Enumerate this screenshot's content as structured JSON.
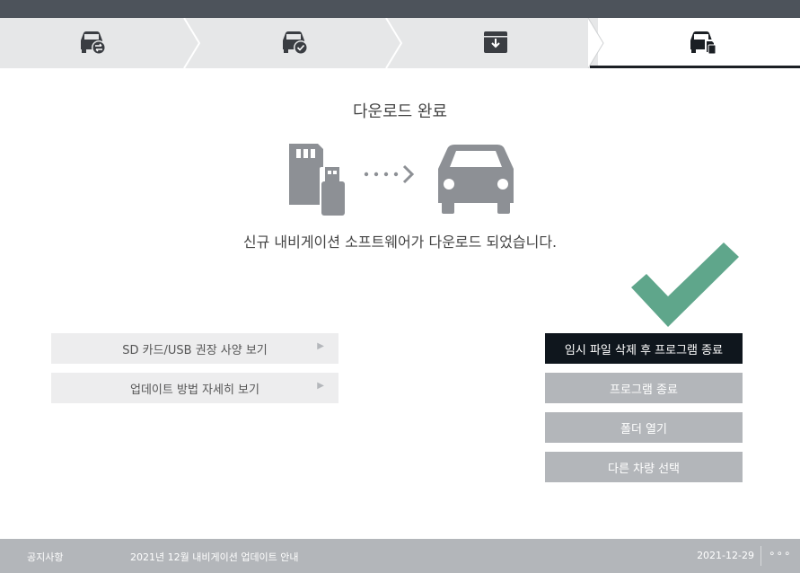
{
  "steps": [
    {
      "icon": "car-swap-icon",
      "active": false
    },
    {
      "icon": "car-check-icon",
      "active": false
    },
    {
      "icon": "download-box-icon",
      "active": false
    },
    {
      "icon": "car-sd-card-icon",
      "active": true
    }
  ],
  "main": {
    "title": "다운로드 완료",
    "message": "신규 내비게이션 소프트웨어가 다운로드 되었습니다."
  },
  "links": {
    "sd_usb_spec": "SD 카드/USB 권장 사양 보기",
    "update_method": "업데이트 방법 자세히 보기",
    "arrow": "▶"
  },
  "actions": {
    "delete_and_exit": "임시 파일 삭제 후 프로그램 종료",
    "exit": "프로그램 종료",
    "open_folder": "폴더 열기",
    "select_other_vehicle": "다른 차량 선택"
  },
  "footer": {
    "label": "공지사항",
    "notice": "2021년 12월 내비게이션 업데이트 안내",
    "date": "2021-12-29",
    "more": "∘∘∘"
  },
  "colors": {
    "accent_check": "#5fa68b",
    "primary_button": "#0f161d",
    "secondary_button": "#b3b6ba",
    "icon_gray": "#8d9095",
    "header_dark": "#4d535b"
  }
}
